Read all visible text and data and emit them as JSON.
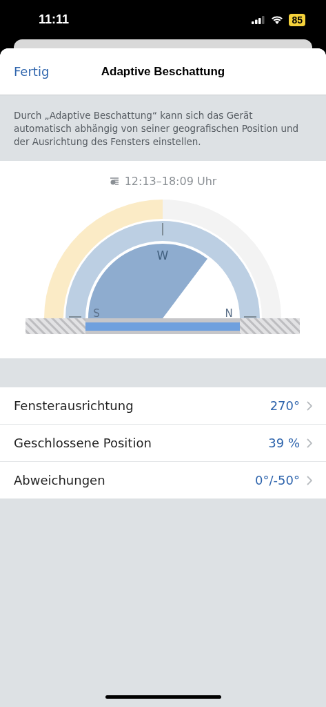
{
  "status_bar": {
    "time": "11:11",
    "battery": "85"
  },
  "header": {
    "done": "Fertig",
    "title": "Adaptive Beschattung"
  },
  "description": "Durch „Adaptive Beschattung“ kann sich das Gerät automatisch abhängig von seiner geografischen Position und der Ausrichtung des Fensters einstellen.",
  "sun_time": "12:13–18:09 Uhr",
  "compass": {
    "labels": [
      "S",
      "W",
      "N"
    ]
  },
  "settings": [
    {
      "label": "Fensterausrichtung",
      "value": "270°"
    },
    {
      "label": "Geschlossene Position",
      "value": "39 %"
    },
    {
      "label": "Abweichungen",
      "value": "0°/-50°"
    }
  ]
}
